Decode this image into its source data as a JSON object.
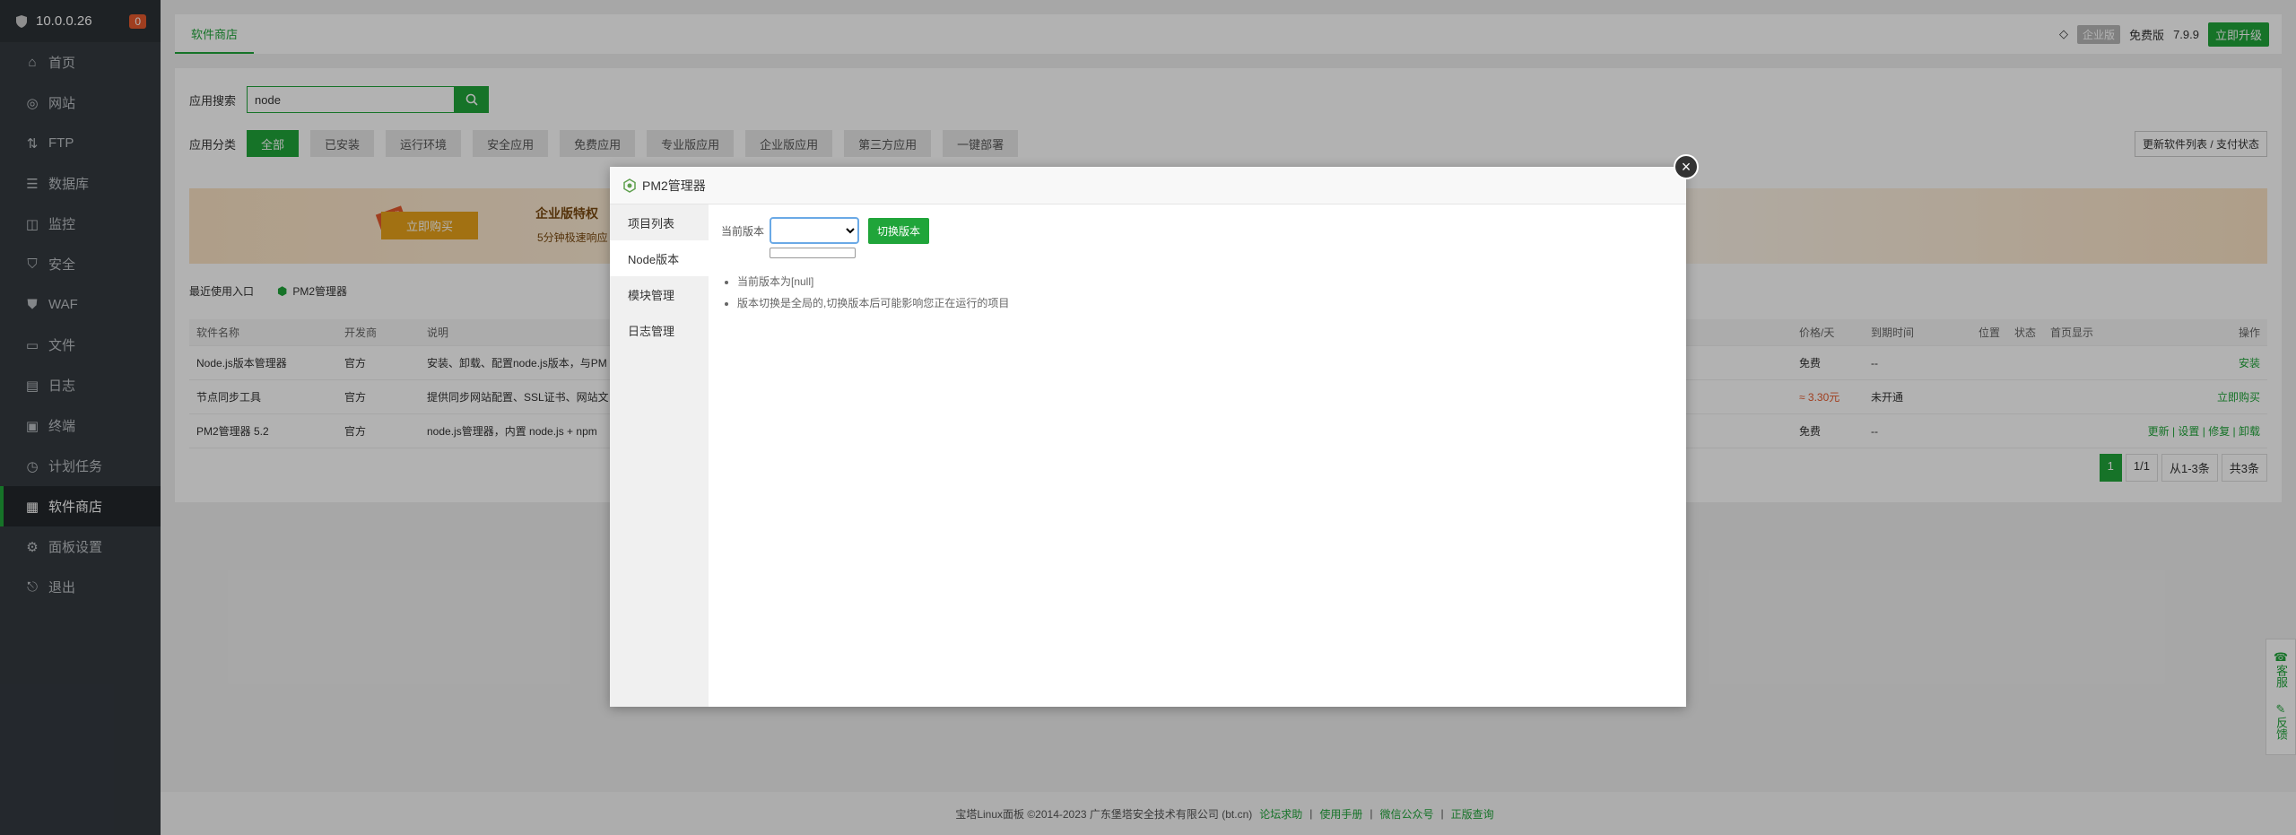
{
  "sidebar": {
    "server_ip": "10.0.0.26",
    "badge_count": "0",
    "items": [
      {
        "label": "首页",
        "icon": "home-icon"
      },
      {
        "label": "网站",
        "icon": "globe-icon"
      },
      {
        "label": "FTP",
        "icon": "ftp-icon"
      },
      {
        "label": "数据库",
        "icon": "database-icon"
      },
      {
        "label": "监控",
        "icon": "monitor-icon"
      },
      {
        "label": "安全",
        "icon": "shield-icon"
      },
      {
        "label": "WAF",
        "icon": "waf-icon"
      },
      {
        "label": "文件",
        "icon": "folder-icon"
      },
      {
        "label": "日志",
        "icon": "log-icon"
      },
      {
        "label": "终端",
        "icon": "terminal-icon"
      },
      {
        "label": "计划任务",
        "icon": "clock-icon"
      },
      {
        "label": "软件商店",
        "icon": "grid-icon",
        "active": true
      },
      {
        "label": "面板设置",
        "icon": "gear-icon"
      },
      {
        "label": "退出",
        "icon": "logout-icon"
      }
    ]
  },
  "topbar": {
    "tab": "软件商店",
    "enterprise": "企业版",
    "free": "免费版",
    "version": "7.9.9",
    "upgrade": "立即升级"
  },
  "store": {
    "search_label": "应用搜索",
    "search_value": "node",
    "category_label": "应用分类",
    "categories": [
      "全部",
      "已安装",
      "运行环境",
      "安全应用",
      "免费应用",
      "专业版应用",
      "企业版应用",
      "第三方应用",
      "一键部署"
    ],
    "refresh_btn": "更新软件列表 / 支付状态",
    "banner_tag": "推荐",
    "banner_buy": "立即购买",
    "banner_title": "企业版特权",
    "banner_sub": "5分钟极速响应",
    "recent_label": "最近使用入口",
    "recent_item": "PM2管理器",
    "table_headers": [
      "软件名称",
      "开发商",
      "说明",
      "价格/天",
      "到期时间",
      "位置",
      "状态",
      "首页显示",
      "操作"
    ],
    "rows": [
      {
        "name": "Node.js版本管理器",
        "dev": "官方",
        "desc": "安装、卸载、配置node.js版本，与PM",
        "price": "免费",
        "expire": "--",
        "op": "安装"
      },
      {
        "name": "节点同步工具",
        "dev": "官方",
        "desc": "提供同步网站配置、SSL证书、网站文",
        "price": "≈ 3.30元",
        "expire": "未开通",
        "op": "立即购买"
      },
      {
        "name": "PM2管理器 5.2",
        "dev": "官方",
        "desc": "node.js管理器，内置 node.js + npm",
        "price": "免费",
        "expire": "--",
        "op": "更新 | 设置 | 修复 | 卸载"
      }
    ],
    "pager": {
      "current": "1",
      "pages": "1/1",
      "range": "从1-3条",
      "total": "共3条"
    }
  },
  "footer": {
    "copyright": "宝塔Linux面板 ©2014-2023 广东堡塔安全技术有限公司 (bt.cn)",
    "links": [
      "论坛求助",
      "使用手册",
      "微信公众号",
      "正版查询"
    ]
  },
  "float": {
    "service": "客服",
    "feedback": "反馈"
  },
  "modal": {
    "title": "PM2管理器",
    "menu": [
      "项目列表",
      "Node版本",
      "模块管理",
      "日志管理"
    ],
    "active_menu": "Node版本",
    "current_version_label": "当前版本",
    "switch_button": "切换版本",
    "tips": [
      "当前版本为[null]",
      "版本切换是全局的,切换版本后可能影响您正在运行的项目"
    ]
  }
}
